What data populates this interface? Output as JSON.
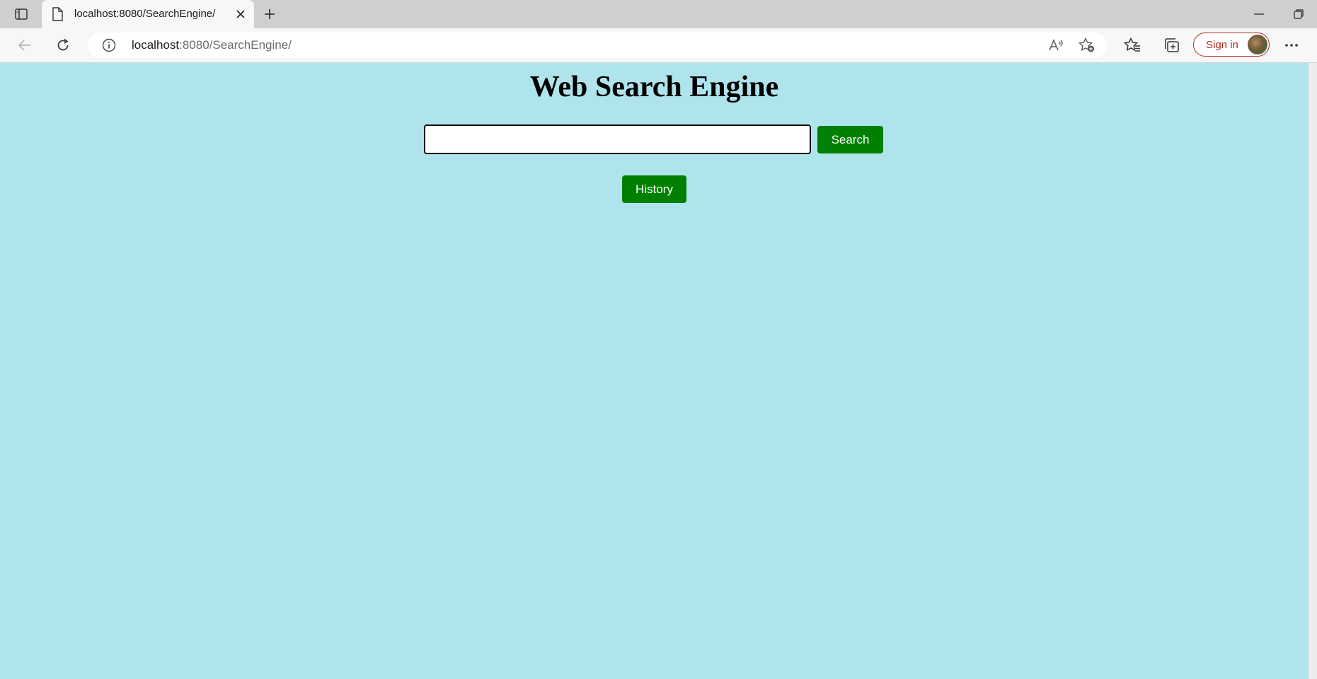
{
  "browser": {
    "tab_title": "localhost:8080/SearchEngine/",
    "url_host": "localhost",
    "url_path": ":8080/SearchEngine/",
    "signin_label": "Sign in"
  },
  "page": {
    "title": "Web Search Engine",
    "search_input_value": "",
    "search_button_label": "Search",
    "history_button_label": "History"
  },
  "colors": {
    "page_background": "#b0e4ec",
    "button_green": "#008000",
    "signin_accent": "#b3261e"
  },
  "icons": [
    "sidebar-toggle-icon",
    "page-icon",
    "close-icon",
    "plus-icon",
    "minimize-icon",
    "restore-icon",
    "back-arrow-icon",
    "refresh-icon",
    "info-icon",
    "read-aloud-icon",
    "add-favorite-icon",
    "favorites-icon",
    "collections-icon",
    "more-icon"
  ]
}
